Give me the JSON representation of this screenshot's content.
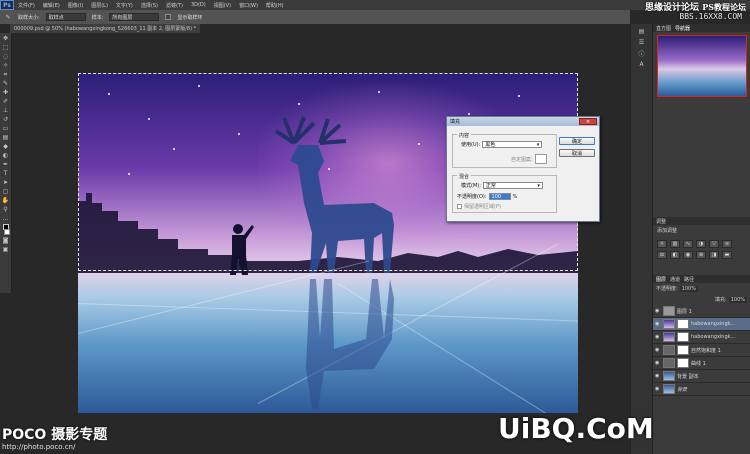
{
  "app": {
    "logo": "Ps"
  },
  "menu": [
    "文件(F)",
    "编辑(E)",
    "图像(I)",
    "图层(L)",
    "文字(Y)",
    "选择(S)",
    "滤镜(T)",
    "3D(D)",
    "视图(V)",
    "窗口(W)",
    "帮助(H)"
  ],
  "watermark": {
    "top": "思缘设计论坛",
    "ps": "PS教程论坛",
    "url": "BBS.16XX8.COM"
  },
  "options": {
    "brush_label": "取样大小:",
    "brush_value": "取样点",
    "sample_label": "样本:",
    "sample_value": "所有图层",
    "show_ring": "显示取样环"
  },
  "document": {
    "tab": "000009.psd @ 50% (habowangxingkong_526603_11 副本 2, 图层蒙版/8) *",
    "close": "×"
  },
  "right_panel": {
    "top_tabs": [
      "直方图",
      "导航器"
    ],
    "adjustments_tabs": [
      "调整"
    ],
    "adjustments_label": "添加调整",
    "layers_tabs": [
      "图层",
      "通道",
      "路径"
    ],
    "opacity_label": "不透明度:",
    "opacity_value": "100%",
    "fill_label": "填充:",
    "fill_value": "100%",
    "layers": [
      {
        "name": "图层 1"
      },
      {
        "name": "habowangxingk..."
      },
      {
        "name": "habowangxingk..."
      },
      {
        "name": "自然饱和度 1"
      },
      {
        "name": "曲线 1"
      },
      {
        "name": "背景 副本"
      },
      {
        "name": "背景"
      }
    ]
  },
  "dialog": {
    "title": "填充",
    "close": "×",
    "content_legend": "内容",
    "use_label": "使用(U):",
    "use_value": "黑色",
    "custom_pattern": "自定图案:",
    "blend_legend": "混合",
    "mode_label": "模式(M):",
    "mode_value": "正常",
    "opacity_label": "不透明度(O):",
    "opacity_value": "100",
    "opacity_unit": "%",
    "preserve": "保留透明区域(P)",
    "ok": "确定",
    "cancel": "取消"
  },
  "brands": {
    "poco": "POCO 摄影专题",
    "poco_url": "http://photo.poco.cn/",
    "uibq": "UiBQ.CoM"
  }
}
